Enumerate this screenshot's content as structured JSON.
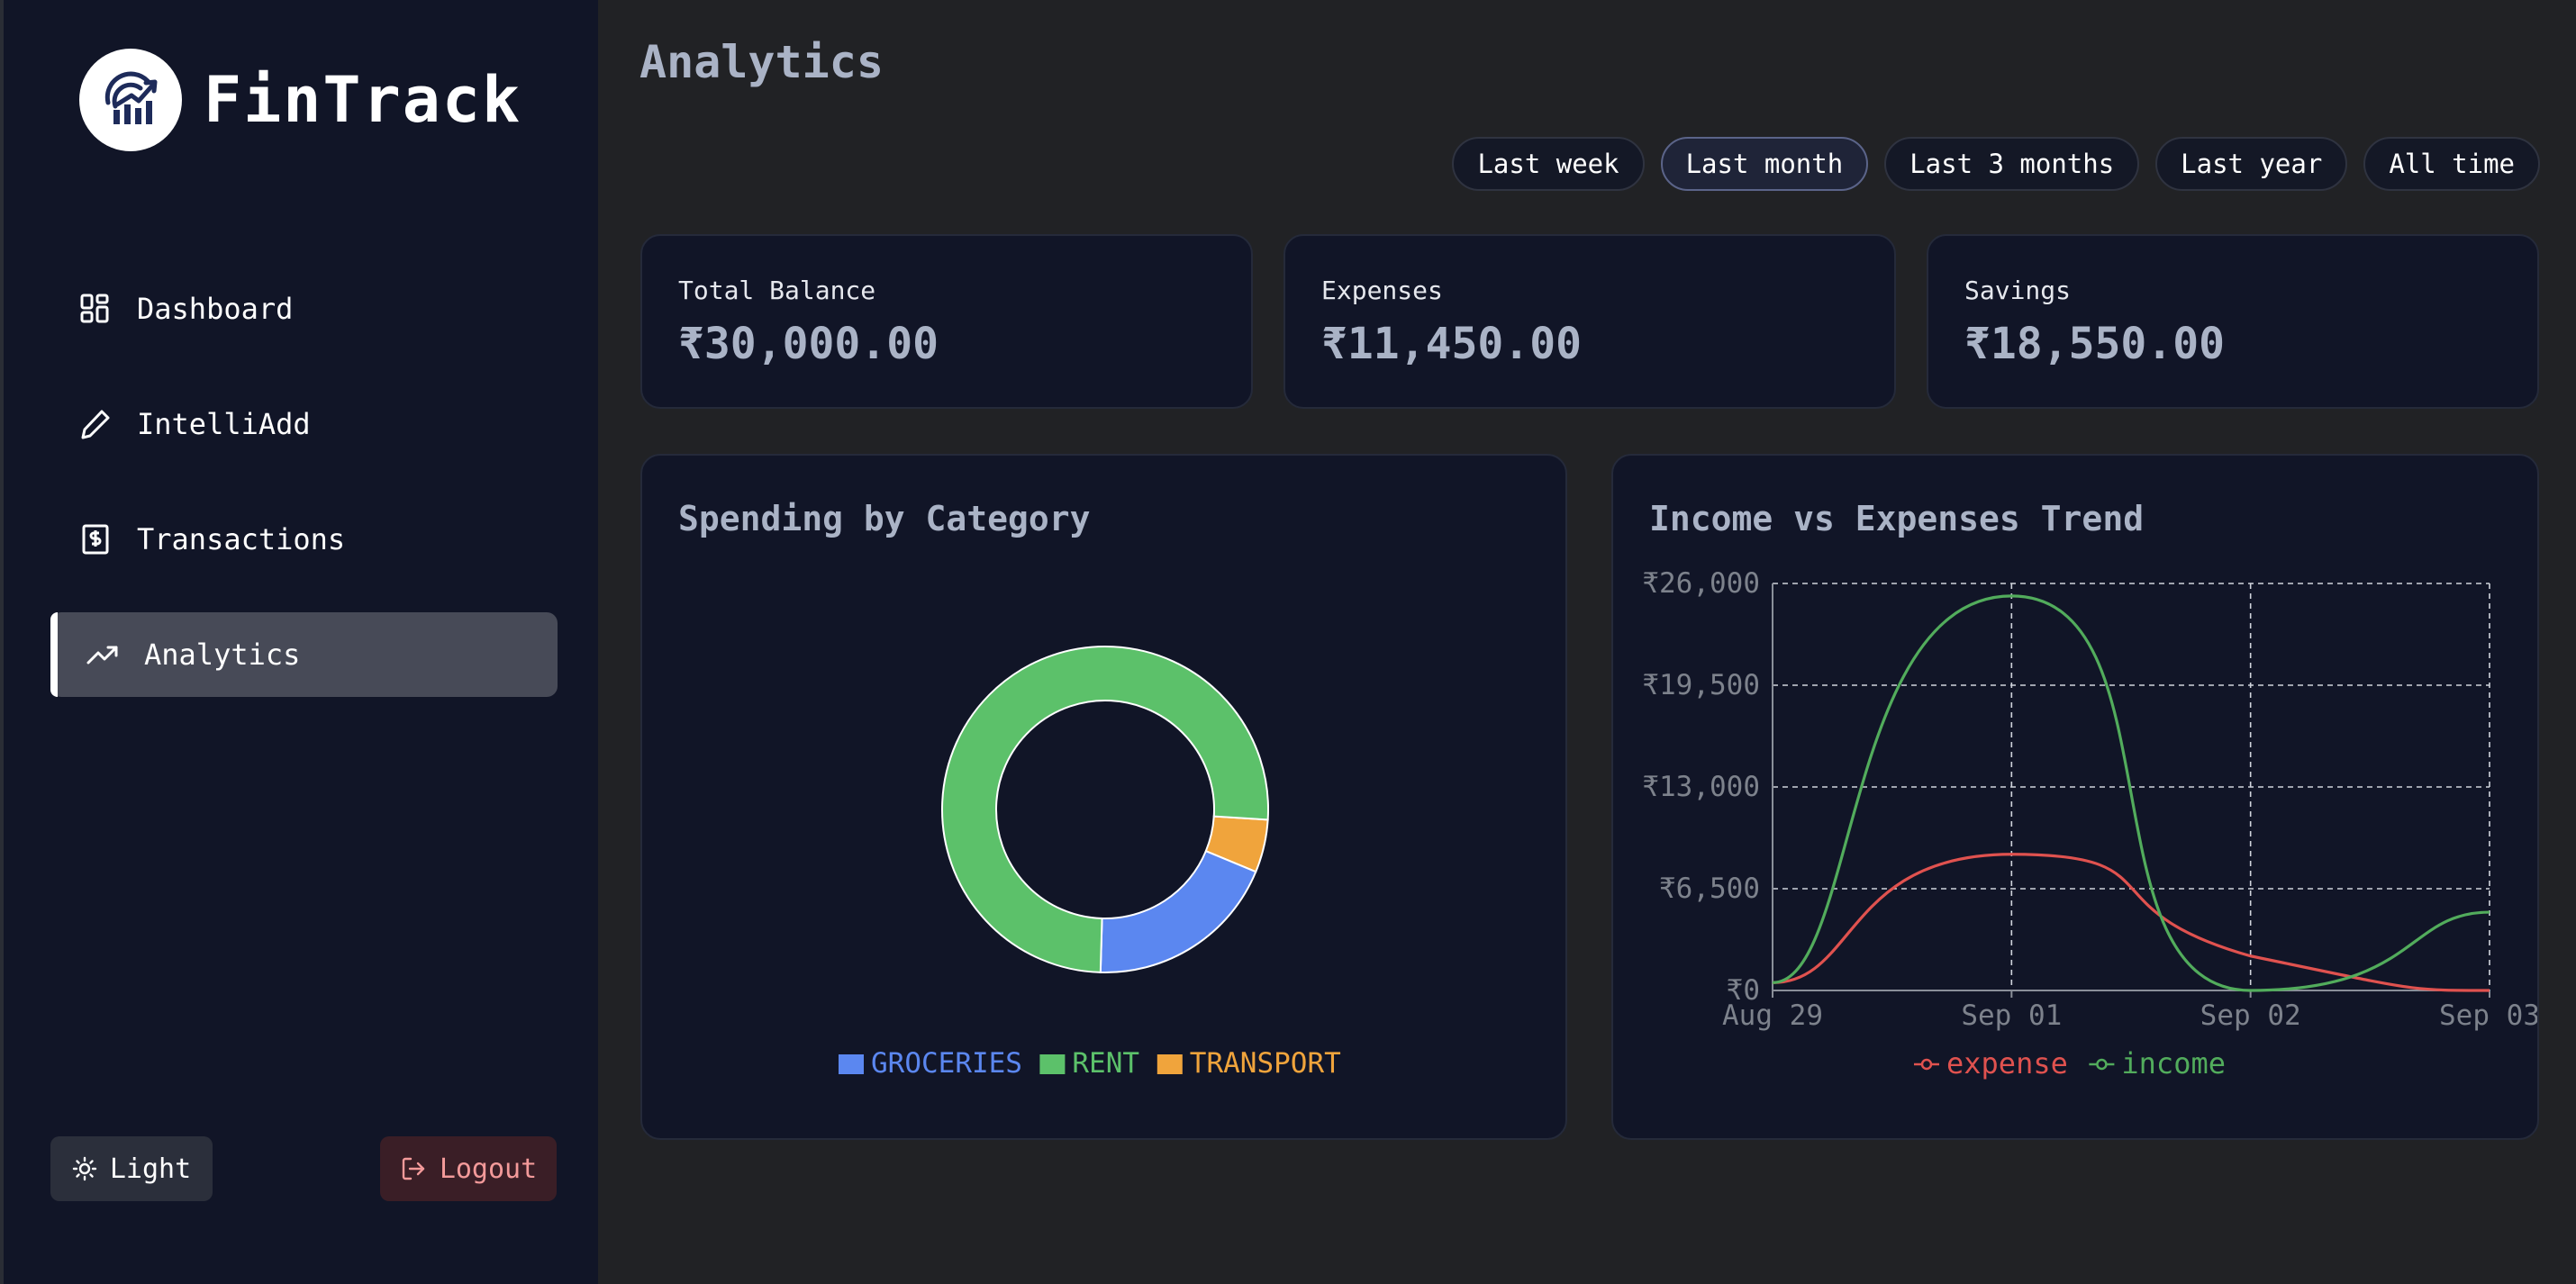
{
  "app": {
    "name": "FinTrack"
  },
  "nav": {
    "items": [
      {
        "label": "Dashboard",
        "icon": "dashboard-icon"
      },
      {
        "label": "IntelliAdd",
        "icon": "pencil-icon"
      },
      {
        "label": "Transactions",
        "icon": "receipt-icon"
      },
      {
        "label": "Analytics",
        "icon": "trending-up-icon",
        "active": true
      }
    ]
  },
  "footer": {
    "theme_label": "Light",
    "logout_label": "Logout"
  },
  "page": {
    "title": "Analytics"
  },
  "filters": {
    "items": [
      "Last week",
      "Last month",
      "Last 3 months",
      "Last year",
      "All time"
    ],
    "selected": "Last month"
  },
  "stats": [
    {
      "label": "Total Balance",
      "value": "₹30,000.00"
    },
    {
      "label": "Expenses",
      "value": "₹11,450.00"
    },
    {
      "label": "Savings",
      "value": "₹18,550.00"
    }
  ],
  "colors": {
    "groceries": "#5b87f0",
    "rent": "#5cc16a",
    "transport": "#f0a43c",
    "expense": "#e0524f",
    "income": "#52ac5c",
    "accent": "#aab3c6"
  },
  "chart_data": [
    {
      "type": "pie",
      "title": "Spending by Category",
      "donut": true,
      "labels": [
        "GROCERIES",
        "RENT",
        "TRANSPORT"
      ],
      "values": [
        2200,
        8650,
        600
      ],
      "legend": "bottom"
    },
    {
      "type": "line",
      "title": "Income vs Expenses Trend",
      "x": [
        "Aug 29",
        "Sep 01",
        "Sep 02",
        "Sep 03"
      ],
      "ylim": [
        0,
        26000
      ],
      "yticks": [
        "₹0",
        "₹6,500",
        "₹13,000",
        "₹19,500",
        "₹26,000"
      ],
      "grid": true,
      "legend": "bottom",
      "series": [
        {
          "name": "expense",
          "values": [
            500,
            8700,
            2200,
            0
          ]
        },
        {
          "name": "income",
          "values": [
            500,
            25200,
            0,
            5000
          ]
        }
      ]
    }
  ]
}
